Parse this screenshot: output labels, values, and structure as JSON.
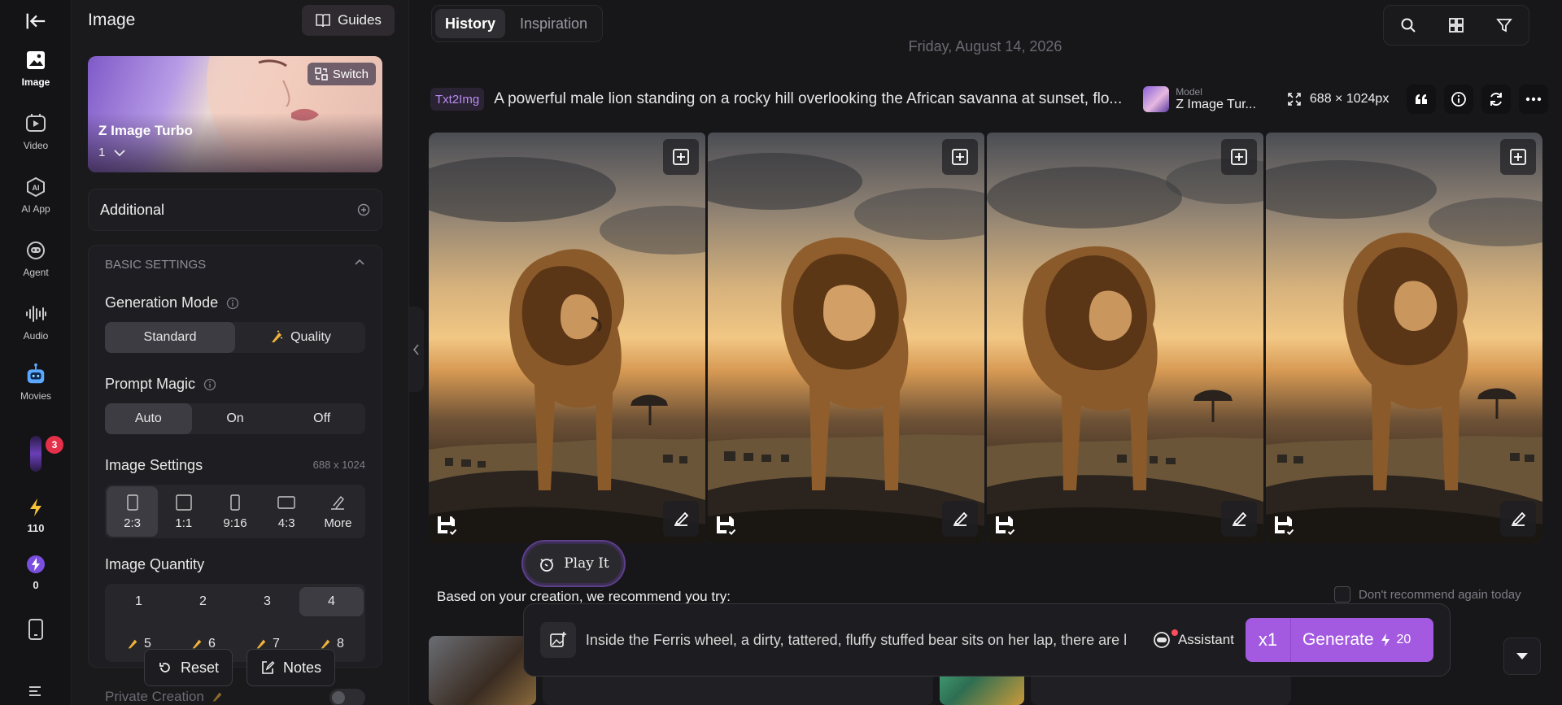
{
  "rail": {
    "items": [
      {
        "label": "Image",
        "icon": "image-icon"
      },
      {
        "label": "Video",
        "icon": "video-icon"
      },
      {
        "label": "AI App",
        "icon": "ai-app-icon"
      },
      {
        "label": "Agent",
        "icon": "agent-icon"
      },
      {
        "label": "Audio",
        "icon": "audio-icon"
      },
      {
        "label": "Movies",
        "icon": "movies-icon"
      }
    ],
    "notification_count": "3",
    "credits_a": "110",
    "credits_b": "0"
  },
  "panel": {
    "title": "Image",
    "guides_label": "Guides",
    "model": {
      "switch_label": "Switch",
      "name": "Z Image Turbo",
      "count": "1"
    },
    "additional_label": "Additional",
    "basic_settings_label": "BASIC SETTINGS",
    "generation_mode": {
      "label": "Generation Mode",
      "options": [
        "Standard",
        "Quality"
      ],
      "selected": "Standard"
    },
    "prompt_magic": {
      "label": "Prompt Magic",
      "options": [
        "Auto",
        "On",
        "Off"
      ],
      "selected": "Auto"
    },
    "image_settings": {
      "label": "Image Settings",
      "size_note": "688 x 1024",
      "ratios": [
        "2:3",
        "1:1",
        "9:16",
        "4:3",
        "More"
      ],
      "selected": "2:3"
    },
    "image_quantity": {
      "label": "Image Quantity",
      "row1": [
        "1",
        "2",
        "3",
        "4"
      ],
      "row2": [
        "5",
        "6",
        "7",
        "8"
      ],
      "selected": "4"
    },
    "private_label": "Private Creation",
    "reset_label": "Reset",
    "notes_label": "Notes"
  },
  "main": {
    "tabs": [
      "History",
      "Inspiration"
    ],
    "active_tab": "History",
    "date": "Friday, August 14, 2026",
    "tag": "Txt2Img",
    "prompt": "A powerful male lion standing on a rocky hill overlooking the African savanna at sunset, flo...",
    "model_small": "Model",
    "model_name": "Z Image Tur...",
    "dimensions": "688 × 1024px",
    "play_label": "Play It",
    "recommend_text": "Based on your creation, we recommend you try:",
    "dont_recommend": "Don't recommend again today",
    "composer_text": "Inside the Ferris wheel, a dirty, tattered, fluffy stuffed bear sits on her lap, there are l",
    "assistant_label": "Assistant",
    "gen_multiplier": "x1",
    "generate_label": "Generate",
    "generate_cost": "20"
  },
  "colors": {
    "accent": "#a35ae0",
    "tag_text": "#b98cf5",
    "badge": "#e5304a"
  }
}
